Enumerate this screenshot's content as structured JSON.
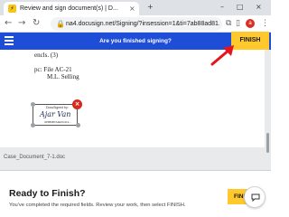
{
  "browser": {
    "tab_title": "Review and sign document(s) | D...",
    "tab_favicon_glyph": "⚡",
    "url": "na4.docusign.net/Signing/?insession=1&ti=7ab88ad81...",
    "avatar_letter": "a"
  },
  "header": {
    "prompt": "Are you finished signing?",
    "finish_label": "FINISH",
    "accent_color": "#1e4dd8",
    "finish_color": "#ffc82c"
  },
  "document": {
    "lines": [
      "encls. (3)",
      "pc: File AC-21",
      "M.L. Selling"
    ],
    "signature": {
      "tag": "DocuSigned by:",
      "script": "Ajar Van",
      "id": "3F5B9B7A4E0C4C1..."
    },
    "filename": "Case_Document_7-1.doc"
  },
  "ready_panel": {
    "title": "Ready to Finish?",
    "description": "You've completed the required fields. Review your work, then select FINISH.",
    "finish_label": "FINISH"
  }
}
